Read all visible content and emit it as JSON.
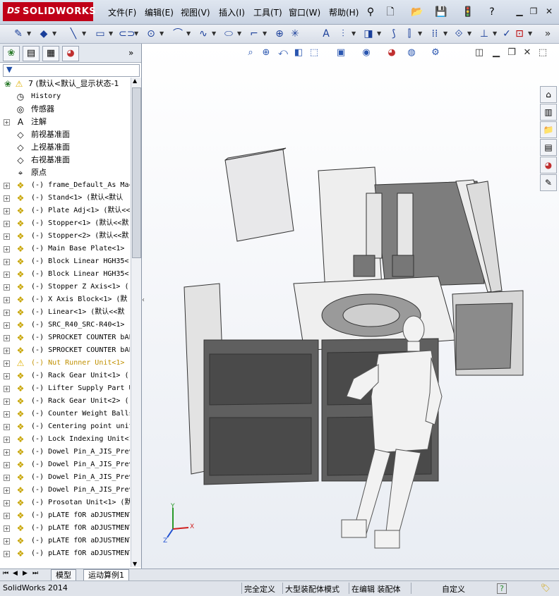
{
  "app": {
    "brand_prefix": "DS",
    "brand_name": "SOLIDWORKS"
  },
  "menu": [
    {
      "label": "文件(F)"
    },
    {
      "label": "编辑(E)"
    },
    {
      "label": "视图(V)"
    },
    {
      "label": "插入(I)"
    },
    {
      "label": "工具(T)"
    },
    {
      "label": "窗口(W)"
    },
    {
      "label": "帮助(H)"
    }
  ],
  "tree": {
    "root": "7  (默认<默认_显示状态-1",
    "items": [
      {
        "label": "History",
        "icon": "history-icon",
        "expand": false
      },
      {
        "label": "传感器",
        "icon": "sensor-icon",
        "expand": false
      },
      {
        "label": "注解",
        "icon": "annotation-icon",
        "expand": true
      },
      {
        "label": "前视基准面",
        "icon": "plane-icon",
        "expand": false
      },
      {
        "label": "上视基准面",
        "icon": "plane-icon",
        "expand": false
      },
      {
        "label": "右视基准面",
        "icon": "plane-icon",
        "expand": false
      },
      {
        "label": "原点",
        "icon": "origin-icon",
        "expand": false
      },
      {
        "label": "(-) frame_Default_As Mac",
        "icon": "part-icon",
        "expand": true
      },
      {
        "label": "(-) Stand<1> (默认<默认",
        "icon": "part-icon",
        "expand": true
      },
      {
        "label": "(-) Plate Adj<1> (默认<<",
        "icon": "part-icon",
        "expand": true
      },
      {
        "label": "(-) Stopper<1> (默认<<默",
        "icon": "part-icon",
        "expand": true
      },
      {
        "label": "(-) Stopper<2> (默认<<默",
        "icon": "part-icon",
        "expand": true
      },
      {
        "label": "(-) Main Base Plate<1>",
        "icon": "part-icon",
        "expand": true
      },
      {
        "label": "(-) Block Linear HGH35<",
        "icon": "part-icon",
        "expand": true
      },
      {
        "label": "(-) Block Linear HGH35<",
        "icon": "part-icon",
        "expand": true
      },
      {
        "label": "(-) Stopper Z Axis<1> (",
        "icon": "part-icon",
        "expand": true
      },
      {
        "label": "(-) X Axis Block<1> (默",
        "icon": "part-icon",
        "expand": true
      },
      {
        "label": "(-) Linear<1> (默认<<默",
        "icon": "part-icon",
        "expand": true
      },
      {
        "label": "(-) SRC_R40_SRC-R40<1>",
        "icon": "part-icon",
        "expand": true
      },
      {
        "label": "(-) SPROCKET COUNTER bAL",
        "icon": "part-icon",
        "expand": true
      },
      {
        "label": "(-) SPROCKET COUNTER bAL",
        "icon": "part-icon",
        "expand": true
      },
      {
        "label": "(-) Nut Runner Unit<1>",
        "icon": "warning-icon",
        "expand": true,
        "warn": true
      },
      {
        "label": "(-) Rack Gear Unit<1> (",
        "icon": "part-icon",
        "expand": true
      },
      {
        "label": "(-) Lifter Supply Part U",
        "icon": "part-icon",
        "expand": true
      },
      {
        "label": "(-) Rack Gear Unit<2> (",
        "icon": "part-icon",
        "expand": true
      },
      {
        "label": "(-) Counter Weight Balls",
        "icon": "part-icon",
        "expand": true
      },
      {
        "label": "(-) Centering point unit",
        "icon": "part-icon",
        "expand": true
      },
      {
        "label": "(-) Lock Indexing Unit<1",
        "icon": "part-icon",
        "expand": true
      },
      {
        "label": "(-) Dowel Pin_A_JIS_Prev",
        "icon": "part-icon",
        "expand": true
      },
      {
        "label": "(-) Dowel Pin_A_JIS_Prev",
        "icon": "part-icon",
        "expand": true
      },
      {
        "label": "(-) Dowel Pin_A_JIS_Prev",
        "icon": "part-icon",
        "expand": true
      },
      {
        "label": "(-) Dowel Pin_A_JIS_Prev",
        "icon": "part-icon",
        "expand": true
      },
      {
        "label": "(-) Prosotan Unit<1> (默",
        "icon": "part-icon",
        "expand": true
      },
      {
        "label": "(-) pLATE fOR aDJUSTMENT",
        "icon": "part-icon",
        "expand": true
      },
      {
        "label": "(-) pLATE fOR aDJUSTMENT",
        "icon": "part-icon",
        "expand": true
      },
      {
        "label": "(-) pLATE fOR aDJUSTMENT",
        "icon": "part-icon",
        "expand": true
      },
      {
        "label": "(-) pLATE fOR aDJUSTMENT",
        "icon": "part-icon",
        "expand": true
      }
    ]
  },
  "bottom_tabs": [
    {
      "label": "模型"
    },
    {
      "label": "运动算例1"
    }
  ],
  "status": {
    "app_version": "SolidWorks 2014",
    "definition": "完全定义",
    "mode": "大型装配体模式",
    "editing": "在编辑 装配体",
    "units": "自定义"
  },
  "colors": {
    "accent": "#c00018",
    "warning": "#e0b000",
    "part": "#c7a400"
  }
}
